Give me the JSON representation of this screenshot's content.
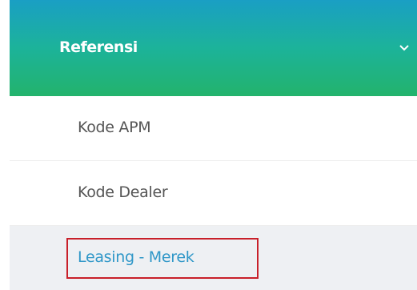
{
  "menu": {
    "header": {
      "label": "Referensi",
      "chevron_icon": "chevron-down-icon"
    },
    "items": [
      {
        "label": "Kode APM",
        "active": false
      },
      {
        "label": "Kode Dealer",
        "active": false
      },
      {
        "label": "Leasing - Merek",
        "active": true
      }
    ]
  },
  "colors": {
    "header_gradient_top": "#1a9fc4",
    "header_gradient_bottom": "#23b36c",
    "active_text": "#2f97c8",
    "active_background": "#eef0f3",
    "highlight_border": "#c8202a"
  }
}
